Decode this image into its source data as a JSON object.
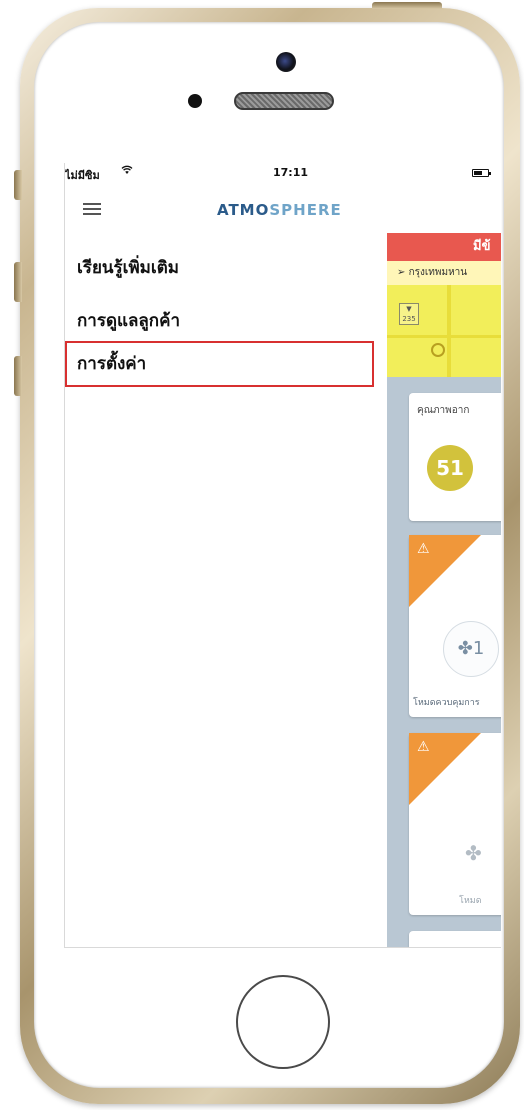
{
  "status_bar": {
    "carrier": "ไม่มีซิม",
    "time": "17:11"
  },
  "header": {
    "title_dark": "ATMO",
    "title_light": "SPHERE"
  },
  "menu": {
    "items": [
      {
        "label": "เรียนรู้เพิ่มเติม"
      },
      {
        "label": "การดูแลลูกค้า"
      },
      {
        "label": "การตั้งค่า",
        "selected": true
      }
    ]
  },
  "dashboard": {
    "alert_text": "มีข้",
    "location": "กรุงเทพมหาน",
    "map_badge": "235",
    "air_quality_title": "คุณภาพอาก",
    "aqi_value": "51",
    "device1_fan": "1",
    "device1_mode": "โหมดควบคุมการ",
    "device2_mode": "โหมด"
  },
  "colors": {
    "alert_red": "#e8584f",
    "warning_orange": "#f0973a",
    "aqi_yellow": "#d2c23c",
    "selection_border": "#d83030",
    "brand_blue": "#2b5b8a"
  }
}
